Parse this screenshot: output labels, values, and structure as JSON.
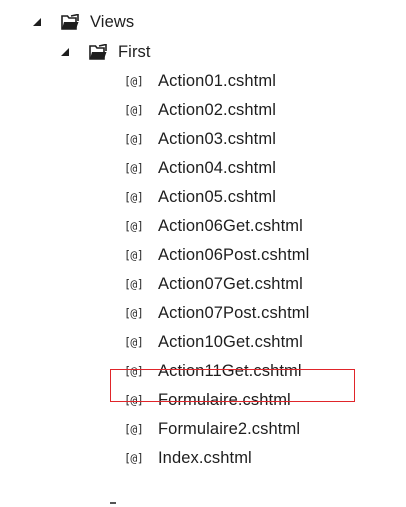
{
  "tree": {
    "root": {
      "label": "Views",
      "expanded": true,
      "icon": "folder-open-icon",
      "expander_icon": "expanded-triangle-icon"
    },
    "child": {
      "label": "First",
      "expanded": true,
      "icon": "folder-open-icon",
      "expander_icon": "expanded-triangle-icon"
    },
    "file_icon_text": "[@]",
    "files": [
      {
        "label": "Action01.cshtml"
      },
      {
        "label": "Action02.cshtml"
      },
      {
        "label": "Action03.cshtml"
      },
      {
        "label": "Action04.cshtml"
      },
      {
        "label": "Action05.cshtml"
      },
      {
        "label": "Action06Get.cshtml"
      },
      {
        "label": "Action06Post.cshtml"
      },
      {
        "label": "Action07Get.cshtml"
      },
      {
        "label": "Action07Post.cshtml"
      },
      {
        "label": "Action10Get.cshtml"
      },
      {
        "label": "Action11Get.cshtml",
        "highlighted": true
      },
      {
        "label": "Formulaire.cshtml"
      },
      {
        "label": "Formulaire2.cshtml"
      },
      {
        "label": "Index.cshtml"
      }
    ],
    "highlight_color": "#e0252a"
  }
}
